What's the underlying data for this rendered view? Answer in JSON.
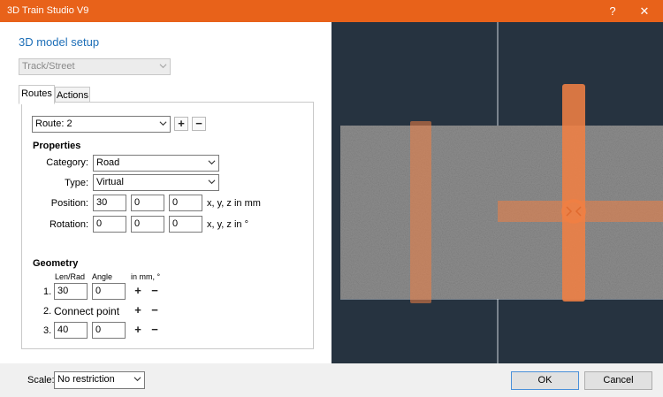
{
  "window": {
    "title": "3D Train Studio V9",
    "help_glyph": "?",
    "close_glyph": "✕"
  },
  "setup": {
    "heading": "3D model setup",
    "model_type": "Track/Street"
  },
  "tabs": [
    {
      "label": "Routes",
      "active": true
    },
    {
      "label": "Actions",
      "active": false
    }
  ],
  "route": {
    "selected": "Route: 2",
    "add_label": "+",
    "remove_label": "−"
  },
  "properties": {
    "heading": "Properties",
    "category_label": "Category:",
    "category_value": "Road",
    "type_label": "Type:",
    "type_value": "Virtual",
    "position_label": "Position:",
    "position": [
      "30",
      "0",
      "0"
    ],
    "position_unit": "x, y, z in mm",
    "rotation_label": "Rotation:",
    "rotation": [
      "0",
      "0",
      "0"
    ],
    "rotation_unit": "x, y, z in °"
  },
  "geometry": {
    "heading": "Geometry",
    "col_len": "Len/Rad",
    "col_angle": "Angle",
    "col_unit": "in mm, °",
    "rows": [
      {
        "index": "1.",
        "len": "30",
        "angle": "0",
        "add": "+",
        "remove": "−"
      },
      {
        "index": "2.",
        "text": "Connect point",
        "add": "+",
        "remove": "−"
      },
      {
        "index": "3.",
        "len": "40",
        "angle": "0",
        "add": "+",
        "remove": "−"
      }
    ]
  },
  "footer": {
    "scale_label": "Scale:",
    "scale_value": "No restriction",
    "ok_label": "OK",
    "cancel_label": "Cancel"
  },
  "colors": {
    "titlebar": "#e8621a",
    "heading": "#1e6fb8",
    "viewport_bg": "#263340",
    "track_orange": "#f07f43"
  },
  "icons": {
    "dropdown": "chevron-down-icon",
    "close": "close-icon",
    "help": "help-icon"
  }
}
